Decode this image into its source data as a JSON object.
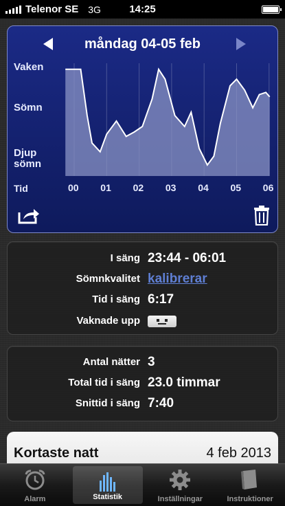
{
  "status": {
    "carrier": "Telenor SE",
    "network": "3G",
    "time": "14:25"
  },
  "graph": {
    "date_title": "måndag 04-05 feb",
    "y_labels": {
      "awake": "Vaken",
      "sleep": "Sömn",
      "deep": "Djup\nsömn"
    },
    "x_axis_label": "Tid",
    "x_ticks": [
      "00",
      "01",
      "02",
      "03",
      "04",
      "05",
      "06"
    ],
    "fill_color": "#8a93c4",
    "line_color": "#ffffff"
  },
  "chart_data": {
    "type": "area",
    "y_categories": [
      "Djup sömn",
      "Sömn",
      "Vaken"
    ],
    "x_labels": [
      "00",
      "01",
      "02",
      "03",
      "04",
      "05",
      "06"
    ],
    "x_hours": [
      23.73,
      0.2,
      0.4,
      0.55,
      0.8,
      1.0,
      1.3,
      1.6,
      1.85,
      2.1,
      2.4,
      2.6,
      2.8,
      3.1,
      3.4,
      3.6,
      3.85,
      4.1,
      4.3,
      4.5,
      4.8,
      5.0,
      5.25,
      5.5,
      5.7,
      5.9,
      6.02
    ],
    "values": [
      0.97,
      0.97,
      0.55,
      0.3,
      0.22,
      0.38,
      0.5,
      0.36,
      0.4,
      0.45,
      0.7,
      0.97,
      0.88,
      0.55,
      0.45,
      0.58,
      0.25,
      0.1,
      0.18,
      0.48,
      0.82,
      0.88,
      0.78,
      0.62,
      0.74,
      0.76,
      0.72
    ],
    "xlabel": "Tid"
  },
  "stats_night": {
    "rows": [
      {
        "label": "I säng",
        "value": "23:44 - 06:01"
      },
      {
        "label": "Sömnkvalitet",
        "value": "kalibrerar"
      },
      {
        "label": "Tid i säng",
        "value": "6:17"
      },
      {
        "label": "Vaknade upp",
        "value": ""
      }
    ],
    "mood_icon": "neutral-face-icon"
  },
  "stats_total": {
    "rows": [
      {
        "label": "Antal nätter",
        "value": "3"
      },
      {
        "label": "Total tid i säng",
        "value": "23.0 timmar"
      },
      {
        "label": "Snittid i säng",
        "value": "7:40"
      }
    ]
  },
  "shortest": {
    "title": "Kortaste natt",
    "date": "4 feb 2013"
  },
  "tabs": [
    {
      "label": "Alarm",
      "icon": "alarm-clock-icon",
      "active": false
    },
    {
      "label": "Statistik",
      "icon": "bar-chart-icon",
      "active": true
    },
    {
      "label": "Inställningar",
      "icon": "gear-icon",
      "active": false
    },
    {
      "label": "Instruktioner",
      "icon": "book-icon",
      "active": false
    }
  ]
}
